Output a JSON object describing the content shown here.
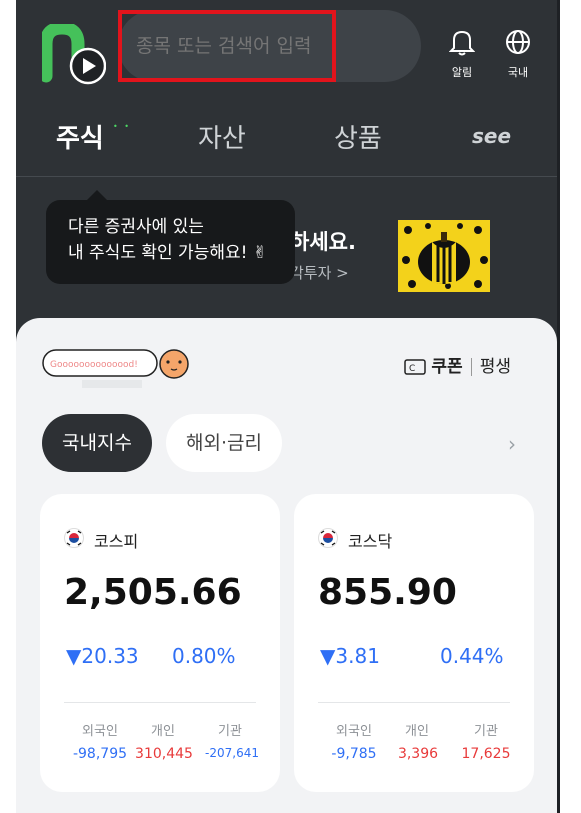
{
  "header": {
    "search_placeholder": "종목 또는 검색어 입력",
    "alerts_label": "알림",
    "region_label": "국내"
  },
  "tabs": [
    {
      "label": "주식",
      "active": true
    },
    {
      "label": "자산",
      "active": false
    },
    {
      "label": "상품",
      "active": false
    },
    {
      "label": "see",
      "active": false
    }
  ],
  "banner": {
    "title_fragment": "하세요.",
    "sub_fragment": "각투자 >",
    "tooltip_line1": "다른 증권사에 있는",
    "tooltip_line2": "내 주식도 확인 가능해요! ✌"
  },
  "panel": {
    "sticker_text": "Goooooooooooood!",
    "coupon_label": "쿠폰",
    "lifetime_label": "평생",
    "filters": [
      {
        "label": "국내지수",
        "active": true
      },
      {
        "label": "해외·금리",
        "active": false
      }
    ]
  },
  "indices": [
    {
      "name": "코스피",
      "value": "2,505.66",
      "change": "▼20.33",
      "change_pct": "0.80%",
      "investors": [
        {
          "label": "외국인",
          "value": "-98,795",
          "trend": "down"
        },
        {
          "label": "개인",
          "value": "310,445",
          "trend": "up"
        },
        {
          "label": "기관",
          "value": "-207,641",
          "trend": "down"
        }
      ]
    },
    {
      "name": "코스닥",
      "value": "855.90",
      "change": "▼3.81",
      "change_pct": "0.44%",
      "investors": [
        {
          "label": "외국인",
          "value": "-9,785",
          "trend": "down"
        },
        {
          "label": "개인",
          "value": "3,396",
          "trend": "up"
        },
        {
          "label": "기관",
          "value": "17,625",
          "trend": "up"
        }
      ]
    }
  ],
  "colors": {
    "background": "#2e3236",
    "panel": "#f2f3f5",
    "down_blue": "#2f6ff5",
    "up_red": "#e83a3a",
    "brand_green": "#4cd964",
    "highlight_red": "#e2141c"
  }
}
